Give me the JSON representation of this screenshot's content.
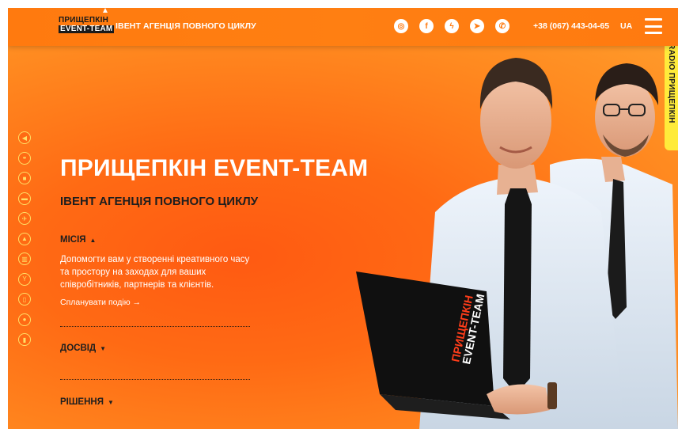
{
  "header": {
    "logo_line1": "ПРИЩЕПКІН",
    "logo_line2": "EVENT-TEAM",
    "tagline": "ІВЕНТ АГЕНЦІЯ ПОВНОГО ЦИКЛУ",
    "socials": [
      {
        "name": "instagram-icon",
        "glyph": "◎"
      },
      {
        "name": "facebook-icon",
        "glyph": "f"
      },
      {
        "name": "messenger-icon",
        "glyph": "ϟ"
      },
      {
        "name": "telegram-icon",
        "glyph": "➤"
      },
      {
        "name": "viber-icon",
        "glyph": "✆"
      }
    ],
    "phone": "+38 (067) 443-04-65",
    "language": "UA"
  },
  "hero": {
    "title": "ПРИЩЕПКІН EVENT-TEAM",
    "subtitle": "ІВЕНТ АГЕНЦІЯ ПОВНОГО ЦИКЛУ",
    "mission_label": "МІСІЯ",
    "mission_arrow": "▲",
    "mission_text": "Допомогти вам у створенні креативного часу та простору на заходах для ваших співробітників, партнерів та клієнтів.",
    "plan_link": "Спланувати подію →",
    "experience_label": "ДОСВІД",
    "experience_arrow": "▼",
    "solutions_label": "РІШЕННЯ",
    "solutions_arrow": "▼",
    "laptop_text_1": "ПРИЩЕПКІН",
    "laptop_text_2": "EVENT-TEAM"
  },
  "side_icons": [
    {
      "name": "megaphone-icon",
      "glyph": "◀"
    },
    {
      "name": "bicycle-icon",
      "glyph": "⚭"
    },
    {
      "name": "briefcase-icon",
      "glyph": "■"
    },
    {
      "name": "bus-icon",
      "glyph": "▬"
    },
    {
      "name": "airplane-icon",
      "glyph": "✈"
    },
    {
      "name": "rocket-icon",
      "glyph": "▲"
    },
    {
      "name": "building-icon",
      "glyph": "▥"
    },
    {
      "name": "trophy-icon",
      "glyph": "Y"
    },
    {
      "name": "phone-icon",
      "glyph": "▯"
    },
    {
      "name": "ball-icon",
      "glyph": "●"
    },
    {
      "name": "bottle-icon",
      "glyph": "▮"
    }
  ],
  "radio_tab": "RADIO ПРИЩЕПКІН",
  "colors": {
    "accent": "#ff7a10",
    "hero_center": "#ff5a12",
    "icon_outline": "#ffe066",
    "radio_tab": "#ffeb3b",
    "dark_text": "#1e1e1e"
  }
}
